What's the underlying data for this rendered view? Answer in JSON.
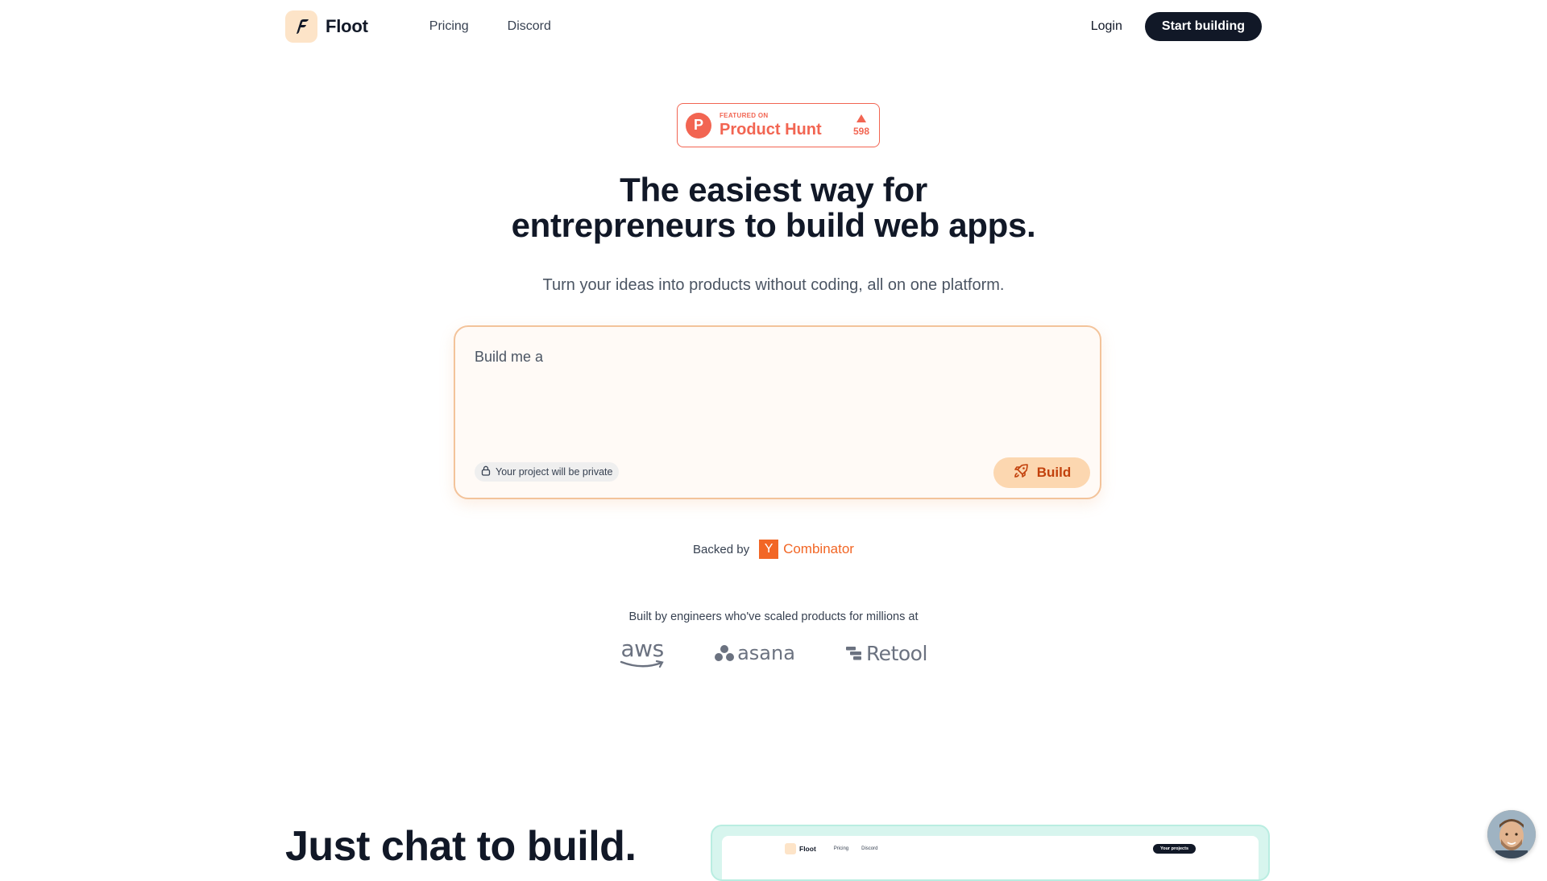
{
  "nav": {
    "brand": "Floot",
    "links": [
      "Pricing",
      "Discord"
    ],
    "login": "Login",
    "cta": "Start building"
  },
  "product_hunt": {
    "featured": "FEATURED ON",
    "name": "Product Hunt",
    "votes": "598",
    "color": "#f26552"
  },
  "hero": {
    "title_line1": "The easiest way for",
    "title_line2": "entrepreneurs to build web apps.",
    "subtitle": "Turn your ideas into products without coding, all on one platform."
  },
  "prompt": {
    "placeholder": "Build me a",
    "private_label": "Your project will be private",
    "build_label": "Build"
  },
  "backed": {
    "label": "Backed by",
    "yc_letter": "Y",
    "yc_name": "Combinator",
    "yc_color": "#f26625"
  },
  "engineers": {
    "text": "Built by engineers who've scaled products for millions at",
    "companies": [
      "aws",
      "asana",
      "Retool"
    ]
  },
  "section2": {
    "title": "Just chat to build.",
    "preview": {
      "brand": "Floot",
      "links": [
        "Pricing",
        "Discord"
      ],
      "button": "Your projects"
    }
  },
  "colors": {
    "primary_dark": "#111827",
    "accent_orange": "#f3c39a",
    "build_button_bg": "#fcd7b0",
    "build_button_text": "#c2410c"
  },
  "icons": [
    "floot-logo-icon",
    "product-hunt-icon",
    "upvote-arrow-icon",
    "lock-icon",
    "rocket-icon",
    "yc-logo-icon",
    "aws-logo-icon",
    "asana-logo-icon",
    "retool-logo-icon",
    "support-avatar"
  ]
}
